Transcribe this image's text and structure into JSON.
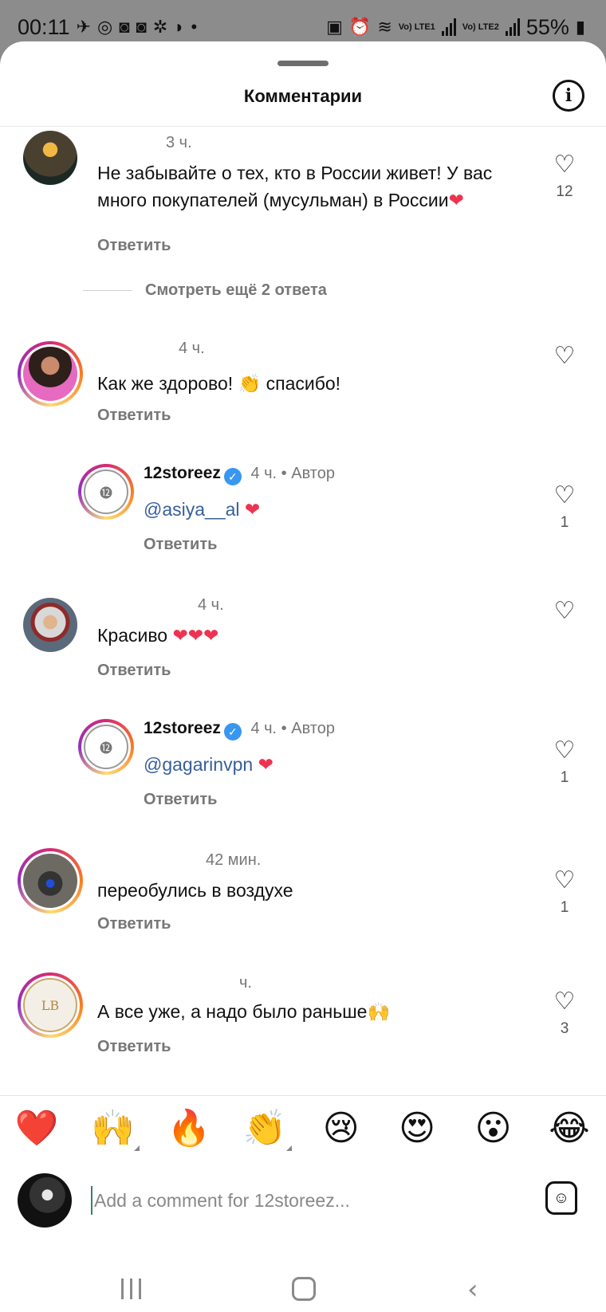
{
  "status_bar": {
    "time": "00:11",
    "battery": "55%",
    "left_icons": [
      "telegram-icon",
      "whatsapp-icon",
      "instagram-icon",
      "instagram-icon",
      "app-icon",
      "app-icon"
    ],
    "sim1_label": "Vo) LTE1",
    "sim2_label": "Vo) LTE2"
  },
  "sheet": {
    "title": "Комментарии"
  },
  "comments": [
    {
      "username": "",
      "time": "3 ч.",
      "text": "Не забывайте о тех, кто в России живет! У вас много покупателей (мусульман) в России",
      "emoji": "❤",
      "reply_label": "Ответить",
      "likes": "12"
    },
    {
      "username": "",
      "time": "4 ч.",
      "text": "Как же здорово!",
      "emoji": "👏",
      "text_after": "спасибо!",
      "reply_label": "Ответить",
      "likes": ""
    },
    {
      "username": "12storeez",
      "time": "4 ч.",
      "author_badge": "• Автор",
      "mention": "@asiya__al",
      "emoji": "❤",
      "reply_label": "Ответить",
      "likes": "1"
    },
    {
      "username": "",
      "time": "4 ч.",
      "text": "Красиво",
      "emoji": "❤❤❤",
      "reply_label": "Ответить",
      "likes": ""
    },
    {
      "username": "12storeez",
      "time": "4 ч.",
      "author_badge": "• Автор",
      "mention": "@gagarinvpn",
      "emoji": "❤",
      "reply_label": "Ответить",
      "likes": "1"
    },
    {
      "username": "",
      "time": "42 мин.",
      "text": "переобулись в воздухе",
      "reply_label": "Ответить",
      "likes": "1"
    },
    {
      "username": "",
      "time": "ч.",
      "text": "А все уже, а надо было раньше",
      "emoji": "🙌",
      "reply_label": "Ответить",
      "likes": "3",
      "avatar_text": "LB"
    }
  ],
  "more_replies": "Смотреть ещё 2 ответа",
  "emoji_bar": [
    "❤️",
    "🙌",
    "🔥",
    "👏",
    "😢",
    "😍",
    "😮",
    "😂"
  ],
  "input": {
    "placeholder": "Add a comment for 12storeez..."
  },
  "colors": {
    "mention": "#375f9b",
    "heart": "#ee3350",
    "verified": "#3897f0"
  }
}
